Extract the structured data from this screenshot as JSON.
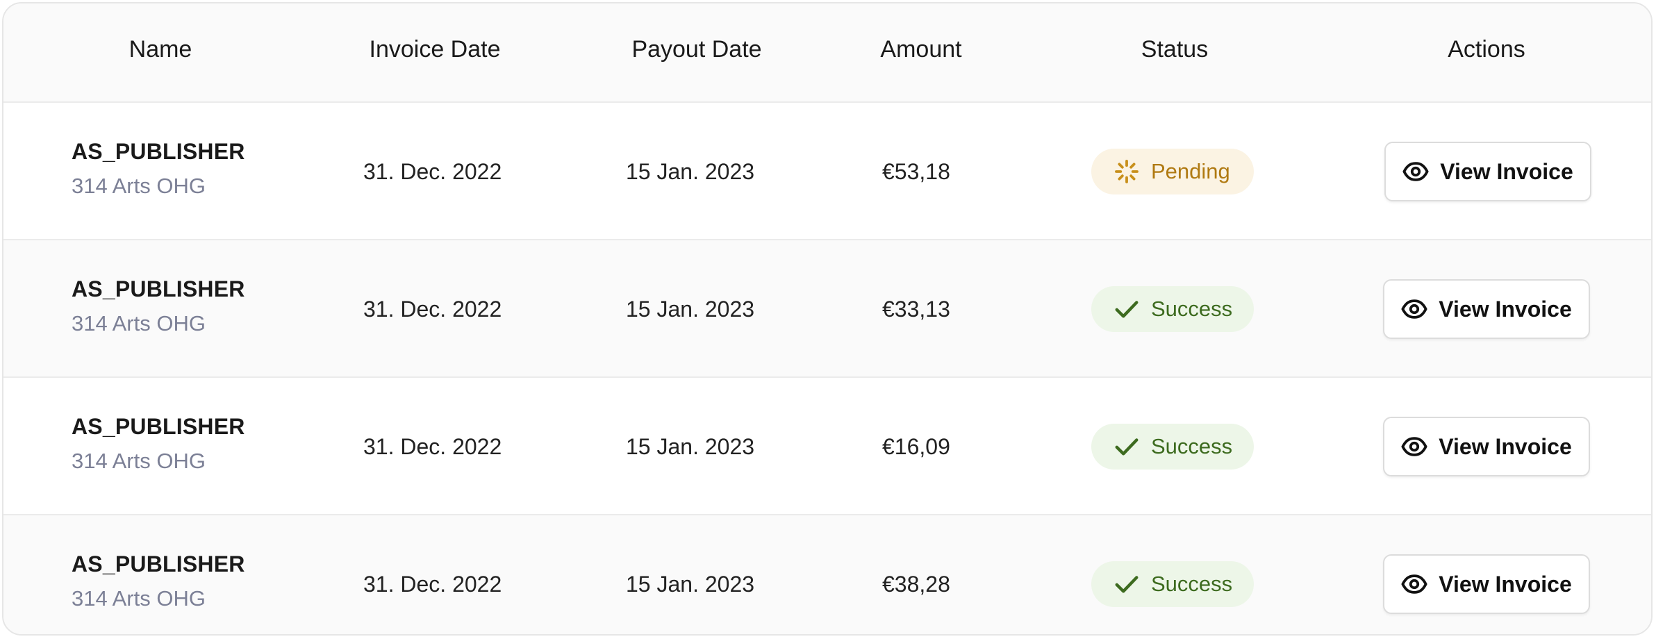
{
  "table": {
    "headers": {
      "name": "Name",
      "invoice_date": "Invoice Date",
      "payout_date": "Payout Date",
      "amount": "Amount",
      "status": "Status",
      "actions": "Actions"
    },
    "rows": [
      {
        "name": "AS_PUBLISHER",
        "company": "314 Arts OHG",
        "invoice_date": "31. Dec. 2022",
        "payout_date": "15 Jan. 2023",
        "amount": "€53,18",
        "status": "Pending",
        "action": "View Invoice"
      },
      {
        "name": "AS_PUBLISHER",
        "company": "314 Arts OHG",
        "invoice_date": "31. Dec. 2022",
        "payout_date": "15 Jan. 2023",
        "amount": "€33,13",
        "status": "Success",
        "action": "View Invoice"
      },
      {
        "name": "AS_PUBLISHER",
        "company": "314 Arts OHG",
        "invoice_date": "31. Dec. 2022",
        "payout_date": "15 Jan. 2023",
        "amount": "€16,09",
        "status": "Success",
        "action": "View Invoice"
      },
      {
        "name": "AS_PUBLISHER",
        "company": "314 Arts OHG",
        "invoice_date": "31. Dec. 2022",
        "payout_date": "15 Jan. 2023",
        "amount": "€38,28",
        "status": "Success",
        "action": "View Invoice"
      }
    ]
  },
  "colors": {
    "pending_text": "#b07a12",
    "pending_bg": "#fbf3e3",
    "success_text": "#3d6b1f",
    "success_bg": "#edf6e8"
  },
  "icons": {
    "pending": "spinner-icon",
    "success": "check-icon",
    "view": "eye-icon"
  }
}
